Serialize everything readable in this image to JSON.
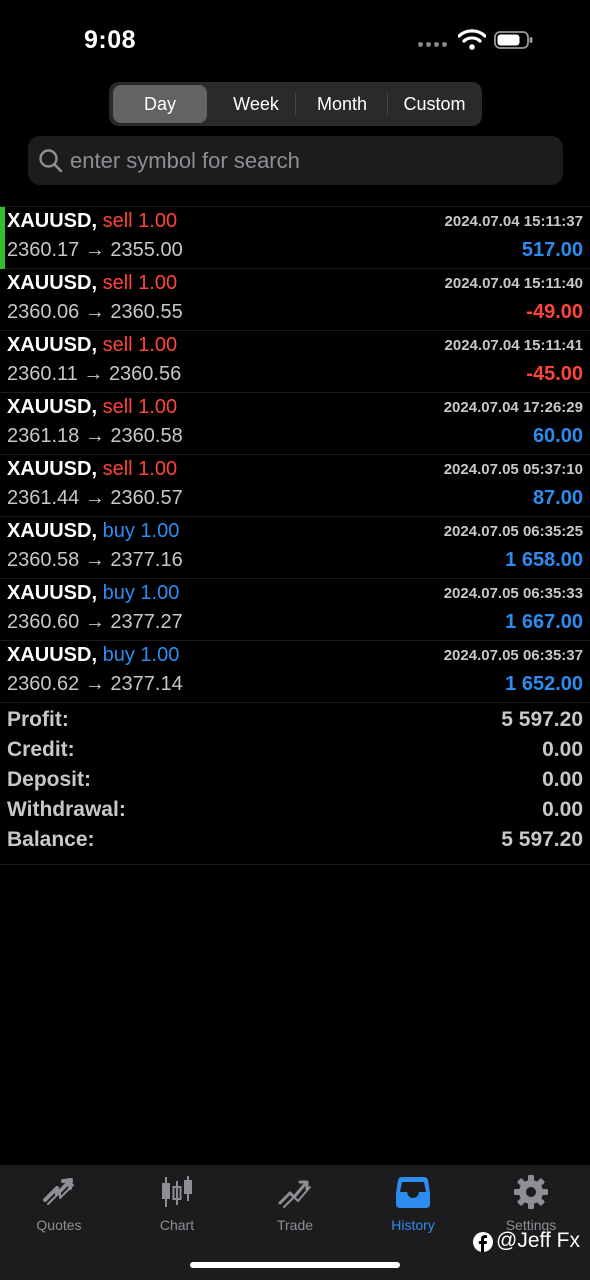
{
  "status_bar": {
    "time": "9:08"
  },
  "period_tabs": [
    {
      "label": "Day",
      "active": true
    },
    {
      "label": "Week",
      "active": false
    },
    {
      "label": "Month",
      "active": false
    },
    {
      "label": "Custom",
      "active": false
    }
  ],
  "search": {
    "placeholder": "enter symbol for search"
  },
  "trades": [
    {
      "symbol": "XAUUSD,",
      "type": "sell",
      "volume": "1.00",
      "open_price": "2360.17",
      "arrow": "→",
      "close_price": "2355.00",
      "time": "2024.07.04 15:11:37",
      "profit": "517.00"
    },
    {
      "symbol": "XAUUSD,",
      "type": "sell",
      "volume": "1.00",
      "open_price": "2360.06",
      "arrow": "→",
      "close_price": "2360.55",
      "time": "2024.07.04 15:11:40",
      "profit": "-49.00"
    },
    {
      "symbol": "XAUUSD,",
      "type": "sell",
      "volume": "1.00",
      "open_price": "2360.11",
      "arrow": "→",
      "close_price": "2360.56",
      "time": "2024.07.04 15:11:41",
      "profit": "-45.00"
    },
    {
      "symbol": "XAUUSD,",
      "type": "sell",
      "volume": "1.00",
      "open_price": "2361.18",
      "arrow": "→",
      "close_price": "2360.58",
      "time": "2024.07.04 17:26:29",
      "profit": "60.00"
    },
    {
      "symbol": "XAUUSD,",
      "type": "sell",
      "volume": "1.00",
      "open_price": "2361.44",
      "arrow": "→",
      "close_price": "2360.57",
      "time": "2024.07.05 05:37:10",
      "profit": "87.00"
    },
    {
      "symbol": "XAUUSD,",
      "type": "buy",
      "volume": "1.00",
      "open_price": "2360.58",
      "arrow": "→",
      "close_price": "2377.16",
      "time": "2024.07.05 06:35:25",
      "profit": "1 658.00"
    },
    {
      "symbol": "XAUUSD,",
      "type": "buy",
      "volume": "1.00",
      "open_price": "2360.60",
      "arrow": "→",
      "close_price": "2377.27",
      "time": "2024.07.05 06:35:33",
      "profit": "1 667.00"
    },
    {
      "symbol": "XAUUSD,",
      "type": "buy",
      "volume": "1.00",
      "open_price": "2360.62",
      "arrow": "→",
      "close_price": "2377.14",
      "time": "2024.07.05 06:35:37",
      "profit": "1 652.00"
    }
  ],
  "summary": [
    {
      "label": "Profit:",
      "value": "5 597.20"
    },
    {
      "label": "Credit:",
      "value": "0.00"
    },
    {
      "label": "Deposit:",
      "value": "0.00"
    },
    {
      "label": "Withdrawal:",
      "value": "0.00"
    },
    {
      "label": "Balance:",
      "value": "5 597.20"
    }
  ],
  "tab_bar": [
    {
      "label": "Quotes",
      "icon": "quotes-icon",
      "active": false
    },
    {
      "label": "Chart",
      "icon": "chart-icon",
      "active": false
    },
    {
      "label": "Trade",
      "icon": "trade-icon",
      "active": false
    },
    {
      "label": "History",
      "icon": "history-icon",
      "active": true
    },
    {
      "label": "Settings",
      "icon": "settings-icon",
      "active": false
    }
  ],
  "watermark": {
    "text": "@Jeff Fx"
  },
  "colors": {
    "sell": "#ff453a",
    "buy": "#2d8cf0",
    "loss": "#ff453a",
    "gain": "#2d8cf0",
    "active_tab": "#2d8cf0",
    "row_accent": "#30c030"
  }
}
